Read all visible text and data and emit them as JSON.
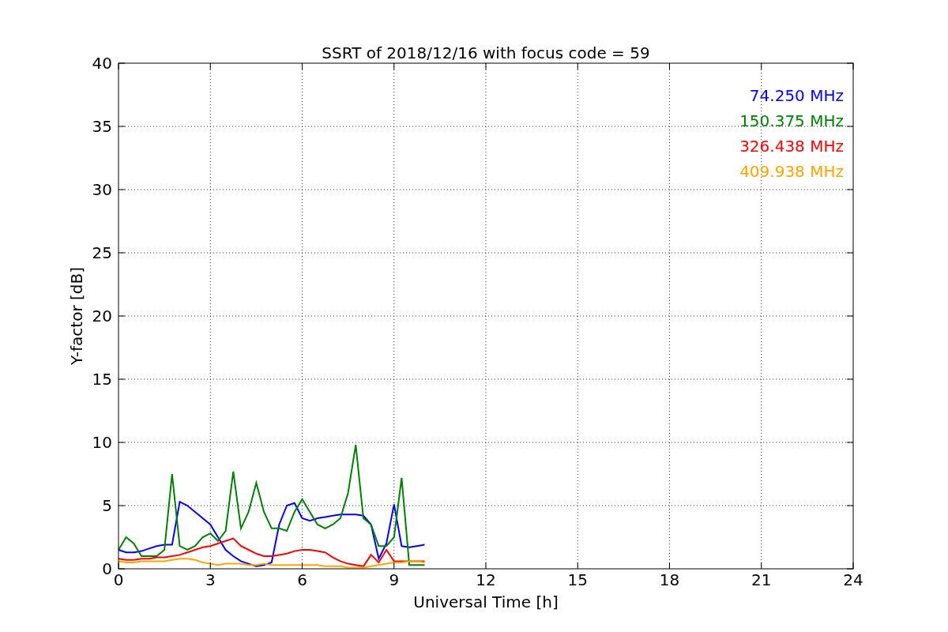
{
  "chart_data": {
    "type": "line",
    "title": "SSRT of 2018/12/16 with focus code = 59",
    "xlabel": "Universal Time [h]",
    "ylabel": "Y-factor [dB]",
    "x": [
      0,
      0.25,
      0.5,
      0.75,
      1,
      1.25,
      1.5,
      1.75,
      2,
      2.25,
      2.5,
      2.75,
      3,
      3.25,
      3.5,
      3.75,
      4,
      4.25,
      4.5,
      4.75,
      5,
      5.25,
      5.5,
      5.75,
      6,
      6.25,
      6.5,
      6.75,
      7,
      7.25,
      7.5,
      7.75,
      8,
      8.25,
      8.5,
      8.75,
      9,
      9.25,
      9.5,
      9.75,
      10
    ],
    "series": [
      {
        "name": "74.250 MHz",
        "color": "#0000ff",
        "values": [
          1.5,
          1.3,
          1.3,
          1.4,
          1.6,
          1.8,
          1.9,
          1.9,
          5.3,
          5.0,
          4.5,
          4.0,
          3.5,
          2.5,
          1.5,
          1.0,
          0.6,
          0.4,
          0.2,
          0.3,
          0.5,
          3.5,
          5.0,
          5.2,
          4.0,
          3.8,
          4.0,
          4.1,
          4.2,
          4.3,
          4.3,
          4.3,
          4.2,
          3.5,
          0.8,
          2.0,
          5.1,
          1.8,
          1.7,
          1.8,
          1.9
        ]
      },
      {
        "name": "150.375 MHz",
        "color": "#008000",
        "values": [
          1.5,
          2.5,
          2.0,
          1.0,
          1.0,
          1.0,
          1.5,
          7.5,
          1.8,
          1.5,
          1.8,
          2.5,
          2.8,
          2.2,
          3.0,
          7.7,
          3.2,
          4.5,
          6.8,
          4.5,
          3.2,
          3.2,
          3.0,
          4.5,
          5.5,
          4.5,
          3.5,
          3.2,
          3.5,
          4.0,
          6.0,
          9.8,
          4.0,
          3.5,
          1.8,
          1.8,
          2.5,
          7.2,
          0.3,
          0.3,
          0.3
        ]
      },
      {
        "name": "326.438 MHz",
        "color": "#ff0000",
        "values": [
          0.8,
          0.7,
          0.7,
          0.8,
          0.8,
          0.9,
          0.9,
          1.0,
          1.1,
          1.3,
          1.5,
          1.7,
          1.8,
          2.0,
          2.2,
          2.4,
          1.8,
          1.5,
          1.2,
          1.0,
          1.0,
          1.1,
          1.2,
          1.4,
          1.5,
          1.5,
          1.4,
          1.3,
          0.9,
          0.6,
          0.4,
          0.3,
          0.2,
          1.1,
          0.5,
          1.5,
          0.6,
          0.6,
          0.6,
          0.6,
          0.6
        ]
      },
      {
        "name": "409.938 MHz",
        "color": "#ffa500",
        "values": [
          0.6,
          0.5,
          0.5,
          0.6,
          0.6,
          0.6,
          0.6,
          0.7,
          0.8,
          0.8,
          0.7,
          0.5,
          0.4,
          0.3,
          0.4,
          0.4,
          0.4,
          0.3,
          0.3,
          0.4,
          0.3,
          0.3,
          0.3,
          0.3,
          0.3,
          0.3,
          0.3,
          0.2,
          0.2,
          0.2,
          0.1,
          0.1,
          0.1,
          0.2,
          0.3,
          0.4,
          0.5,
          0.5,
          0.6,
          0.6,
          0.5
        ]
      }
    ],
    "grid": true,
    "xlim": [
      0,
      24
    ],
    "ylim": [
      0,
      40
    ],
    "xticks": [
      0,
      3,
      6,
      9,
      12,
      15,
      18,
      21,
      24
    ],
    "yticks": [
      0,
      5,
      10,
      15,
      20,
      25,
      30,
      35,
      40
    ]
  }
}
